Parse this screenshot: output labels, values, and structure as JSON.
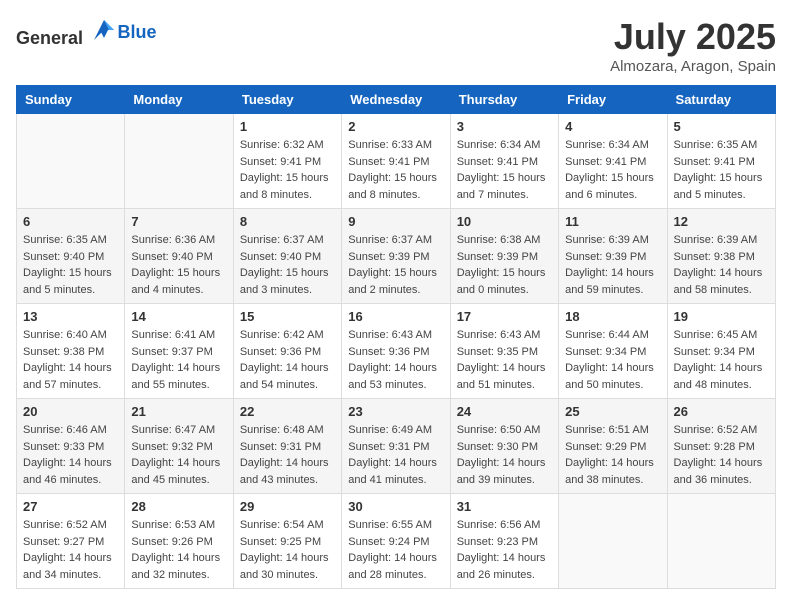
{
  "header": {
    "logo_general": "General",
    "logo_blue": "Blue",
    "month": "July 2025",
    "location": "Almozara, Aragon, Spain"
  },
  "days_of_week": [
    "Sunday",
    "Monday",
    "Tuesday",
    "Wednesday",
    "Thursday",
    "Friday",
    "Saturday"
  ],
  "weeks": [
    [
      {
        "day": "",
        "sunrise": "",
        "sunset": "",
        "daylight": ""
      },
      {
        "day": "",
        "sunrise": "",
        "sunset": "",
        "daylight": ""
      },
      {
        "day": "1",
        "sunrise": "Sunrise: 6:32 AM",
        "sunset": "Sunset: 9:41 PM",
        "daylight": "Daylight: 15 hours and 8 minutes."
      },
      {
        "day": "2",
        "sunrise": "Sunrise: 6:33 AM",
        "sunset": "Sunset: 9:41 PM",
        "daylight": "Daylight: 15 hours and 8 minutes."
      },
      {
        "day": "3",
        "sunrise": "Sunrise: 6:34 AM",
        "sunset": "Sunset: 9:41 PM",
        "daylight": "Daylight: 15 hours and 7 minutes."
      },
      {
        "day": "4",
        "sunrise": "Sunrise: 6:34 AM",
        "sunset": "Sunset: 9:41 PM",
        "daylight": "Daylight: 15 hours and 6 minutes."
      },
      {
        "day": "5",
        "sunrise": "Sunrise: 6:35 AM",
        "sunset": "Sunset: 9:41 PM",
        "daylight": "Daylight: 15 hours and 5 minutes."
      }
    ],
    [
      {
        "day": "6",
        "sunrise": "Sunrise: 6:35 AM",
        "sunset": "Sunset: 9:40 PM",
        "daylight": "Daylight: 15 hours and 5 minutes."
      },
      {
        "day": "7",
        "sunrise": "Sunrise: 6:36 AM",
        "sunset": "Sunset: 9:40 PM",
        "daylight": "Daylight: 15 hours and 4 minutes."
      },
      {
        "day": "8",
        "sunrise": "Sunrise: 6:37 AM",
        "sunset": "Sunset: 9:40 PM",
        "daylight": "Daylight: 15 hours and 3 minutes."
      },
      {
        "day": "9",
        "sunrise": "Sunrise: 6:37 AM",
        "sunset": "Sunset: 9:39 PM",
        "daylight": "Daylight: 15 hours and 2 minutes."
      },
      {
        "day": "10",
        "sunrise": "Sunrise: 6:38 AM",
        "sunset": "Sunset: 9:39 PM",
        "daylight": "Daylight: 15 hours and 0 minutes."
      },
      {
        "day": "11",
        "sunrise": "Sunrise: 6:39 AM",
        "sunset": "Sunset: 9:39 PM",
        "daylight": "Daylight: 14 hours and 59 minutes."
      },
      {
        "day": "12",
        "sunrise": "Sunrise: 6:39 AM",
        "sunset": "Sunset: 9:38 PM",
        "daylight": "Daylight: 14 hours and 58 minutes."
      }
    ],
    [
      {
        "day": "13",
        "sunrise": "Sunrise: 6:40 AM",
        "sunset": "Sunset: 9:38 PM",
        "daylight": "Daylight: 14 hours and 57 minutes."
      },
      {
        "day": "14",
        "sunrise": "Sunrise: 6:41 AM",
        "sunset": "Sunset: 9:37 PM",
        "daylight": "Daylight: 14 hours and 55 minutes."
      },
      {
        "day": "15",
        "sunrise": "Sunrise: 6:42 AM",
        "sunset": "Sunset: 9:36 PM",
        "daylight": "Daylight: 14 hours and 54 minutes."
      },
      {
        "day": "16",
        "sunrise": "Sunrise: 6:43 AM",
        "sunset": "Sunset: 9:36 PM",
        "daylight": "Daylight: 14 hours and 53 minutes."
      },
      {
        "day": "17",
        "sunrise": "Sunrise: 6:43 AM",
        "sunset": "Sunset: 9:35 PM",
        "daylight": "Daylight: 14 hours and 51 minutes."
      },
      {
        "day": "18",
        "sunrise": "Sunrise: 6:44 AM",
        "sunset": "Sunset: 9:34 PM",
        "daylight": "Daylight: 14 hours and 50 minutes."
      },
      {
        "day": "19",
        "sunrise": "Sunrise: 6:45 AM",
        "sunset": "Sunset: 9:34 PM",
        "daylight": "Daylight: 14 hours and 48 minutes."
      }
    ],
    [
      {
        "day": "20",
        "sunrise": "Sunrise: 6:46 AM",
        "sunset": "Sunset: 9:33 PM",
        "daylight": "Daylight: 14 hours and 46 minutes."
      },
      {
        "day": "21",
        "sunrise": "Sunrise: 6:47 AM",
        "sunset": "Sunset: 9:32 PM",
        "daylight": "Daylight: 14 hours and 45 minutes."
      },
      {
        "day": "22",
        "sunrise": "Sunrise: 6:48 AM",
        "sunset": "Sunset: 9:31 PM",
        "daylight": "Daylight: 14 hours and 43 minutes."
      },
      {
        "day": "23",
        "sunrise": "Sunrise: 6:49 AM",
        "sunset": "Sunset: 9:31 PM",
        "daylight": "Daylight: 14 hours and 41 minutes."
      },
      {
        "day": "24",
        "sunrise": "Sunrise: 6:50 AM",
        "sunset": "Sunset: 9:30 PM",
        "daylight": "Daylight: 14 hours and 39 minutes."
      },
      {
        "day": "25",
        "sunrise": "Sunrise: 6:51 AM",
        "sunset": "Sunset: 9:29 PM",
        "daylight": "Daylight: 14 hours and 38 minutes."
      },
      {
        "day": "26",
        "sunrise": "Sunrise: 6:52 AM",
        "sunset": "Sunset: 9:28 PM",
        "daylight": "Daylight: 14 hours and 36 minutes."
      }
    ],
    [
      {
        "day": "27",
        "sunrise": "Sunrise: 6:52 AM",
        "sunset": "Sunset: 9:27 PM",
        "daylight": "Daylight: 14 hours and 34 minutes."
      },
      {
        "day": "28",
        "sunrise": "Sunrise: 6:53 AM",
        "sunset": "Sunset: 9:26 PM",
        "daylight": "Daylight: 14 hours and 32 minutes."
      },
      {
        "day": "29",
        "sunrise": "Sunrise: 6:54 AM",
        "sunset": "Sunset: 9:25 PM",
        "daylight": "Daylight: 14 hours and 30 minutes."
      },
      {
        "day": "30",
        "sunrise": "Sunrise: 6:55 AM",
        "sunset": "Sunset: 9:24 PM",
        "daylight": "Daylight: 14 hours and 28 minutes."
      },
      {
        "day": "31",
        "sunrise": "Sunrise: 6:56 AM",
        "sunset": "Sunset: 9:23 PM",
        "daylight": "Daylight: 14 hours and 26 minutes."
      },
      {
        "day": "",
        "sunrise": "",
        "sunset": "",
        "daylight": ""
      },
      {
        "day": "",
        "sunrise": "",
        "sunset": "",
        "daylight": ""
      }
    ]
  ]
}
